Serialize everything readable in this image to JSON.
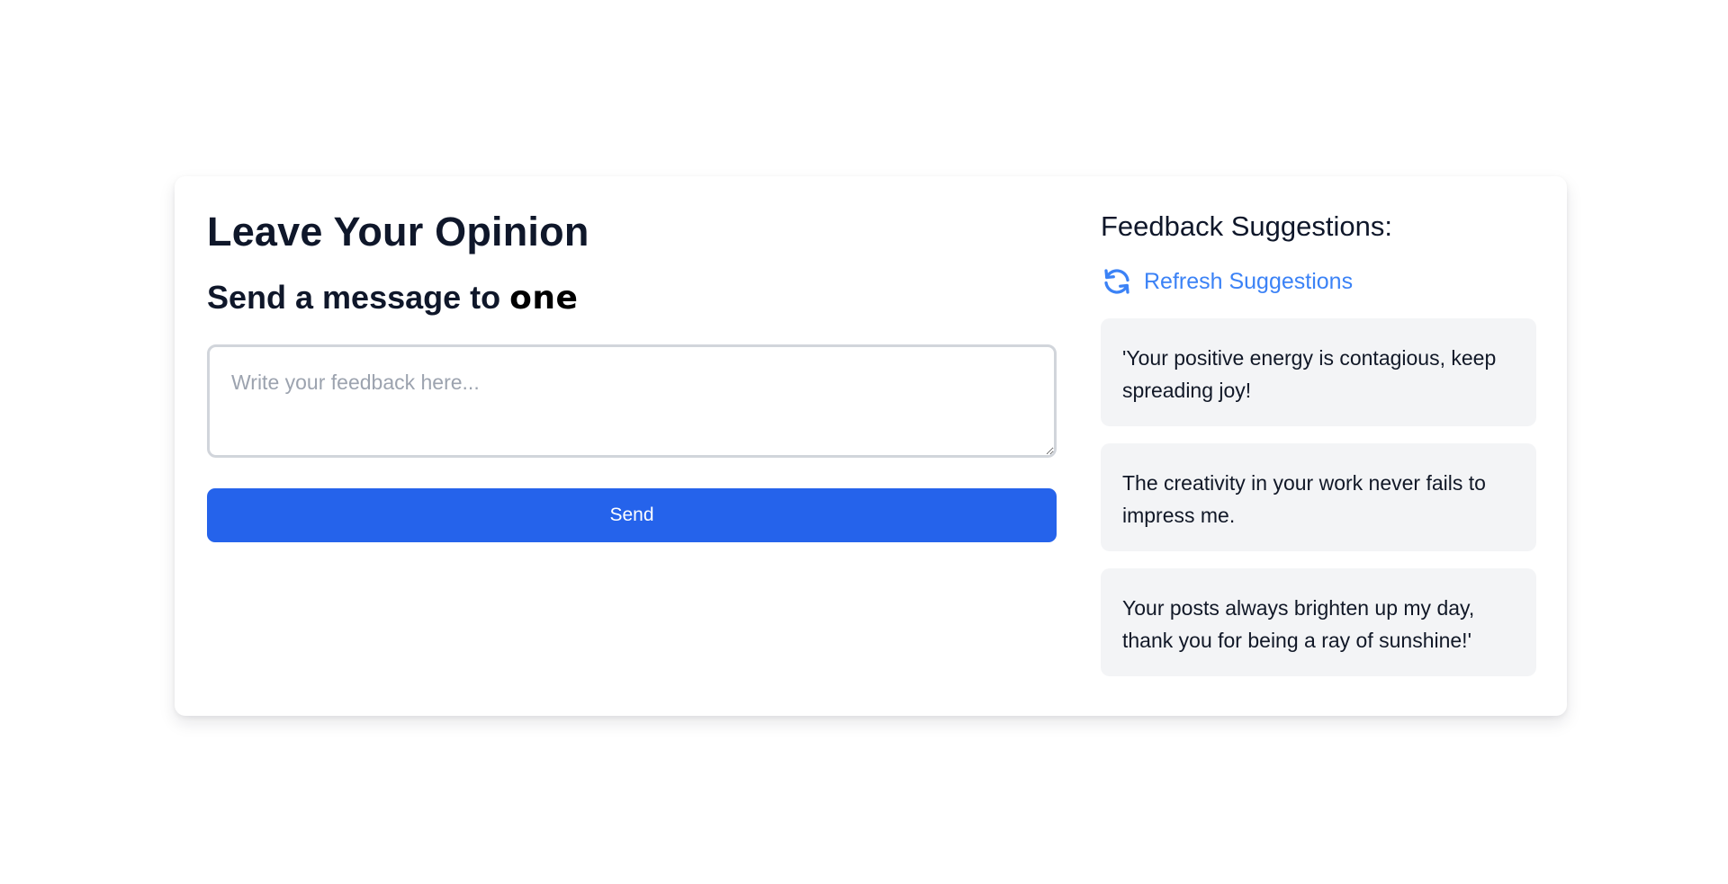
{
  "form": {
    "title": "Leave Your Opinion",
    "subtitle_prefix": "Send a message to",
    "recipient": "one",
    "textarea_placeholder": "Write your feedback here...",
    "textarea_value": "",
    "send_label": "Send"
  },
  "suggestions": {
    "title": "Feedback Suggestions:",
    "refresh_label": "Refresh Suggestions",
    "refresh_icon": "refresh-icon",
    "items": [
      {
        "text": "'Your positive energy is contagious, keep spreading joy!"
      },
      {
        "text": "The creativity in your work never fails to impress me."
      },
      {
        "text": "Your posts always brighten up my day, thank you for being a ray of sunshine!'"
      }
    ]
  },
  "colors": {
    "accent": "#2563eb",
    "link": "#3b82f6",
    "suggestion_bg": "#f3f4f6",
    "border": "#d1d5db"
  }
}
